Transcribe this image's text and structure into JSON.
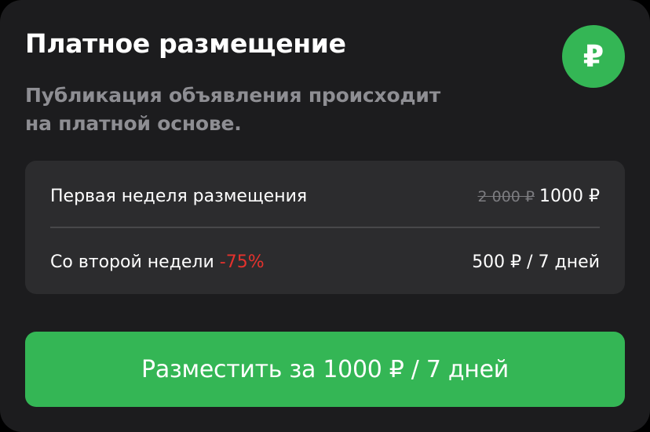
{
  "header": {
    "title": "Платное размещение",
    "badge_symbol": "₽",
    "subtitle_line1": "Публикация объявления происходит",
    "subtitle_line2": "на платной основе."
  },
  "pricing": {
    "rows": [
      {
        "label": "Первая неделя размещения",
        "old_price": "2 000 ₽",
        "price": "1000 ₽"
      },
      {
        "label": "Со второй недели",
        "discount": "-75%",
        "price": "500 ₽ / 7 дней"
      }
    ]
  },
  "cta": {
    "label": "Разместить за 1000 ₽ / 7 дней"
  },
  "colors": {
    "background": "#1c1c1e",
    "card": "#2c2c2e",
    "accent_green": "#34b655",
    "discount_red": "#e5322d",
    "muted_text": "#8e8e93"
  }
}
